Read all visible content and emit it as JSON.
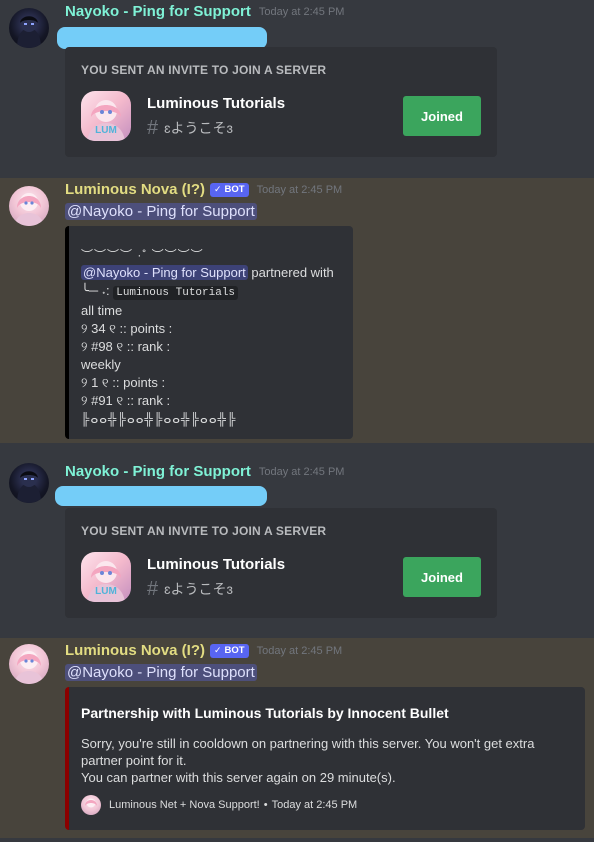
{
  "messages": [
    {
      "username": "Nayoko - Ping for Support",
      "timestamp": "Today at 2:45 PM",
      "invite": {
        "title": "YOU SENT AN INVITE TO JOIN A SERVER",
        "server_name": "Luminous Tutorials",
        "channel": "ɛようこそɜ",
        "button": "Joined"
      }
    },
    {
      "username": "Luminous Nova (I?)",
      "bot_tag": "BOT",
      "timestamp": "Today at 2:45 PM",
      "mention": "@Nayoko - Ping for Support",
      "embed": {
        "deco_top": "︶︶︶︶ ·˚ ︶︶︶︶",
        "mention": "@Nayoko - Ping for Support",
        "partnered_with": "partnered with",
        "tree_prefix": "╰─ ˖:",
        "server_code": "Luminous Tutorials",
        "lines": [
          "all time",
          "୨ 34 ୧ :: points :",
          "୨ #98 ୧ :: rank :",
          "weekly",
          "୨ 1 ୧ :: points :",
          "୨ #91 ୧ :: rank :"
        ],
        "deco_bottom": "╠ⴰⴰ╬╠ⴰⴰ╬╠ⴰⴰ╬╠ⴰⴰ╬╠"
      }
    },
    {
      "username": "Nayoko - Ping for Support",
      "timestamp": "Today at 2:45 PM",
      "invite": {
        "title": "YOU SENT AN INVITE TO JOIN A SERVER",
        "server_name": "Luminous Tutorials",
        "channel": "ɛようこそɜ",
        "button": "Joined"
      }
    },
    {
      "username": "Luminous Nova (I?)",
      "bot_tag": "BOT",
      "timestamp": "Today at 2:45 PM",
      "mention": "@Nayoko - Ping for Support",
      "embed": {
        "title": "Partnership with Luminous Tutorials by Innocent Bullet",
        "description_1": "Sorry, you're still in cooldown on partnering with this server. You won't get extra partner point for it.",
        "description_2": "You can partner with this server again on 29 minute(s).",
        "footer_text": "Luminous Net + Nova Support!",
        "footer_separator": "•",
        "footer_time": "Today at 2:45 PM",
        "color": "#8b0000"
      }
    }
  ],
  "colors": {
    "background": "#36393f",
    "highlight": "#48443c",
    "embed_bg": "#2f3136",
    "joined_button": "#3ba55d",
    "bot_tag": "#5865f2",
    "redaction": "#74cdf8"
  }
}
